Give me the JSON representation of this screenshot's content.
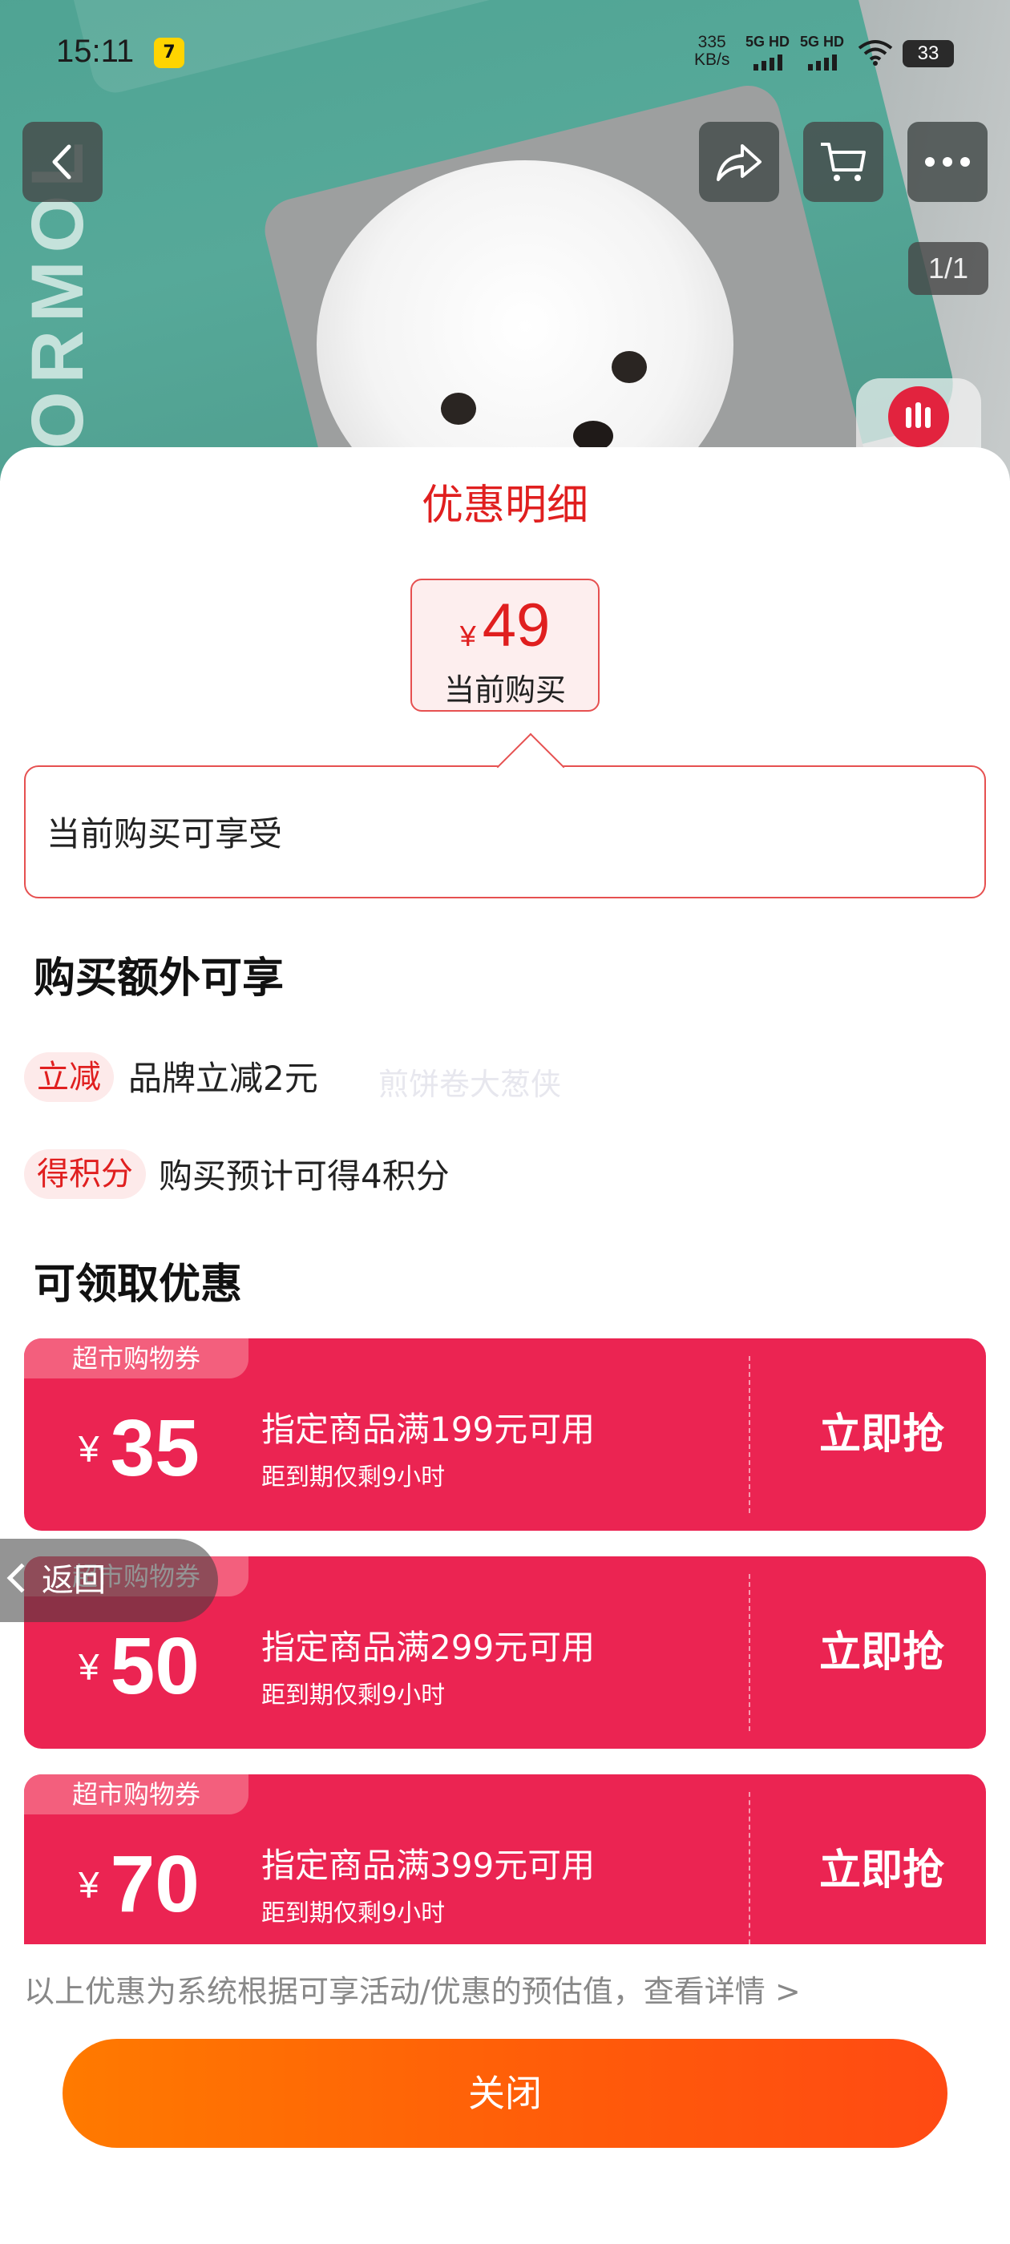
{
  "status_bar": {
    "time": "15:11",
    "app_badge": "7",
    "net_speed_value": "335",
    "net_speed_unit": "KB/s",
    "net1": "5G HD",
    "net2": "5G HD",
    "battery": "33"
  },
  "hero": {
    "pager": "1/1",
    "bag_text": "ORMOL"
  },
  "sheet": {
    "title": "优惠明细",
    "price_symbol": "¥",
    "price_value": "49",
    "price_label": "当前购买",
    "current_enjoy": "当前购买可享受",
    "extra_heading": "购买额外可享",
    "extra_items": [
      {
        "tag": "立减",
        "text": "品牌立减2元"
      },
      {
        "tag": "得积分",
        "text": "购买预计可得4积分"
      }
    ],
    "watermark": "煎饼卷大葱侠",
    "coupons_heading": "可领取优惠",
    "coupons": [
      {
        "tag": "超市购物券",
        "symbol": "¥",
        "amount": "35",
        "condition": "指定商品满199元可用",
        "expiry": "距到期仅剩9小时",
        "action": "立即抢"
      },
      {
        "tag": "超市购物券",
        "symbol": "¥",
        "amount": "50",
        "condition": "指定商品满299元可用",
        "expiry": "距到期仅剩9小时",
        "action": "立即抢"
      },
      {
        "tag": "超市购物券",
        "symbol": "¥",
        "amount": "70",
        "condition": "指定商品满399元可用",
        "expiry": "距到期仅剩9小时",
        "action": "立即抢"
      }
    ],
    "footnote": "以上优惠为系统根据可享活动/优惠的预估值，查看详情 >",
    "close_label": "关闭"
  },
  "floating_back": {
    "label": "返回"
  },
  "colors": {
    "accent_red": "#e01f1f",
    "coupon_bg": "#eb2452",
    "close_gradient_start": "#ff7a00",
    "close_gradient_end": "#ff4a13"
  }
}
